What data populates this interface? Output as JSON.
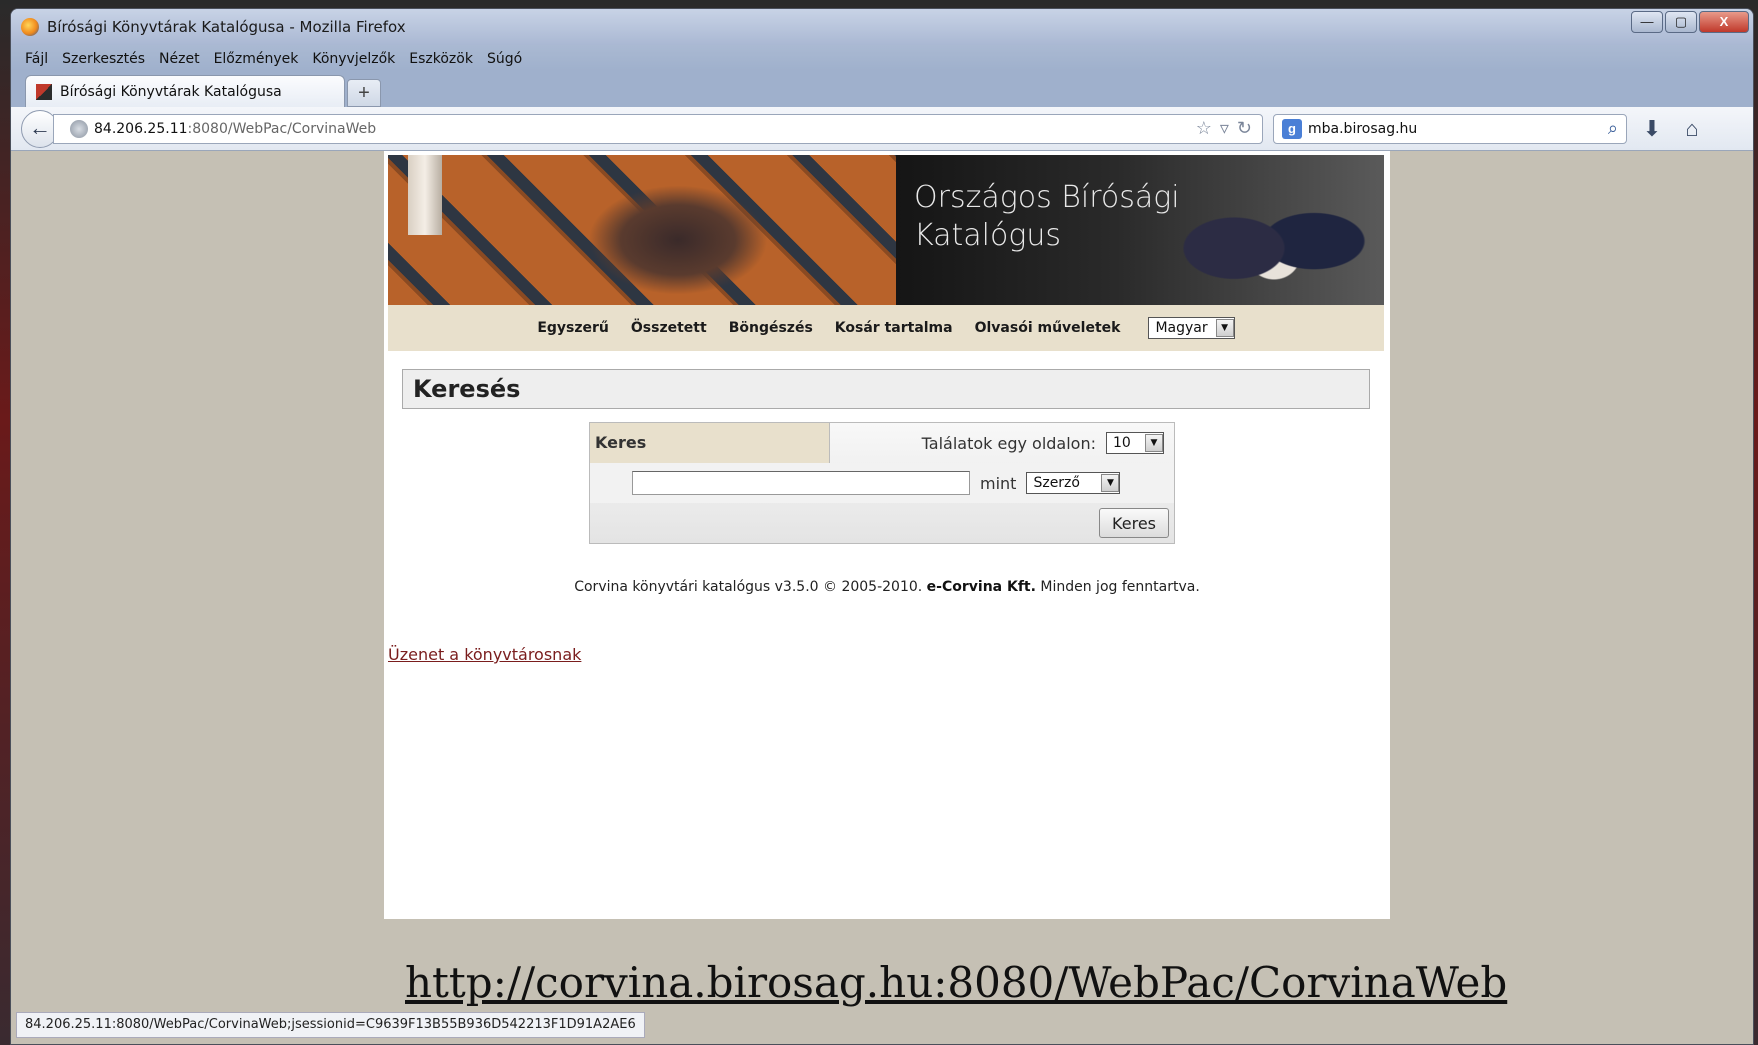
{
  "window": {
    "title": "Bírósági Könyvtárak Katalógusa - Mozilla Firefox",
    "controls": {
      "minimize": "—",
      "maximize": "▢",
      "close": "X"
    }
  },
  "menubar": [
    "Fájl",
    "Szerkesztés",
    "Nézet",
    "Előzmények",
    "Könyvjelzők",
    "Eszközök",
    "Súgó"
  ],
  "tab": {
    "label": "Bírósági Könyvtárak Katalógusa",
    "new_tab": "+"
  },
  "navbar": {
    "url_host": "84.206.25.11",
    "url_path": ":8080/WebPac/CorvinaWeb",
    "search_value": "mba.birosag.hu"
  },
  "page": {
    "banner_title_line1": "Országos Bírósági",
    "banner_title_line2": "Katalógus",
    "nav": [
      "Egyszerű",
      "Összetett",
      "Böngészés",
      "Kosár tartalma",
      "Olvasói műveletek"
    ],
    "language": "Magyar",
    "section_title": "Keresés",
    "search": {
      "tab_label": "Keres",
      "per_page_label": "Találatok egy oldalon:",
      "per_page_value": "10",
      "query_value": "",
      "mint_label": "mint",
      "field_value": "Szerző",
      "submit_label": "Keres"
    },
    "footer_prefix": "Corvina könyvtári katalógus v3.5.0 © 2005-2010.",
    "footer_company": "e-Corvina Kft.",
    "footer_suffix": "Minden jog fenntartva.",
    "message_link": "Üzenet a könyvtárosnak"
  },
  "overlay_url": "http://corvina.birosag.hu:8080/WebPac/CorvinaWeb",
  "statusbar": "84.206.25.11:8080/WebPac/CorvinaWeb;jsessionid=C9639F13B55B936D542213F1D91A2AE6"
}
